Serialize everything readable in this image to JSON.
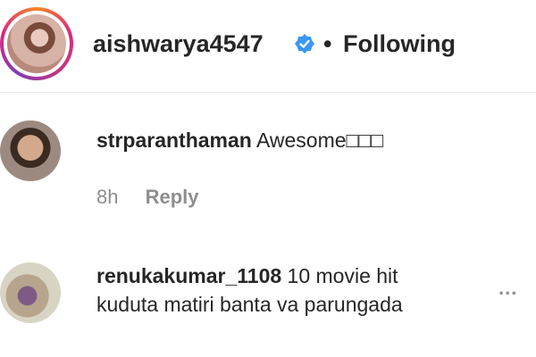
{
  "post_header": {
    "username": "aishwarya4547",
    "separator": "•",
    "follow_status": "Following",
    "verified_icon": "verified-badge-icon",
    "accent_color": "#3897f0"
  },
  "comments": [
    {
      "username": "strparanthaman",
      "text": "Awesome□□□",
      "time": "8h",
      "reply_label": "Reply"
    },
    {
      "username": "renukakumar_1108",
      "text_line1": "10 movie hit",
      "text_line2": "kuduta matiri banta va parungada",
      "more_label": "..."
    }
  ]
}
